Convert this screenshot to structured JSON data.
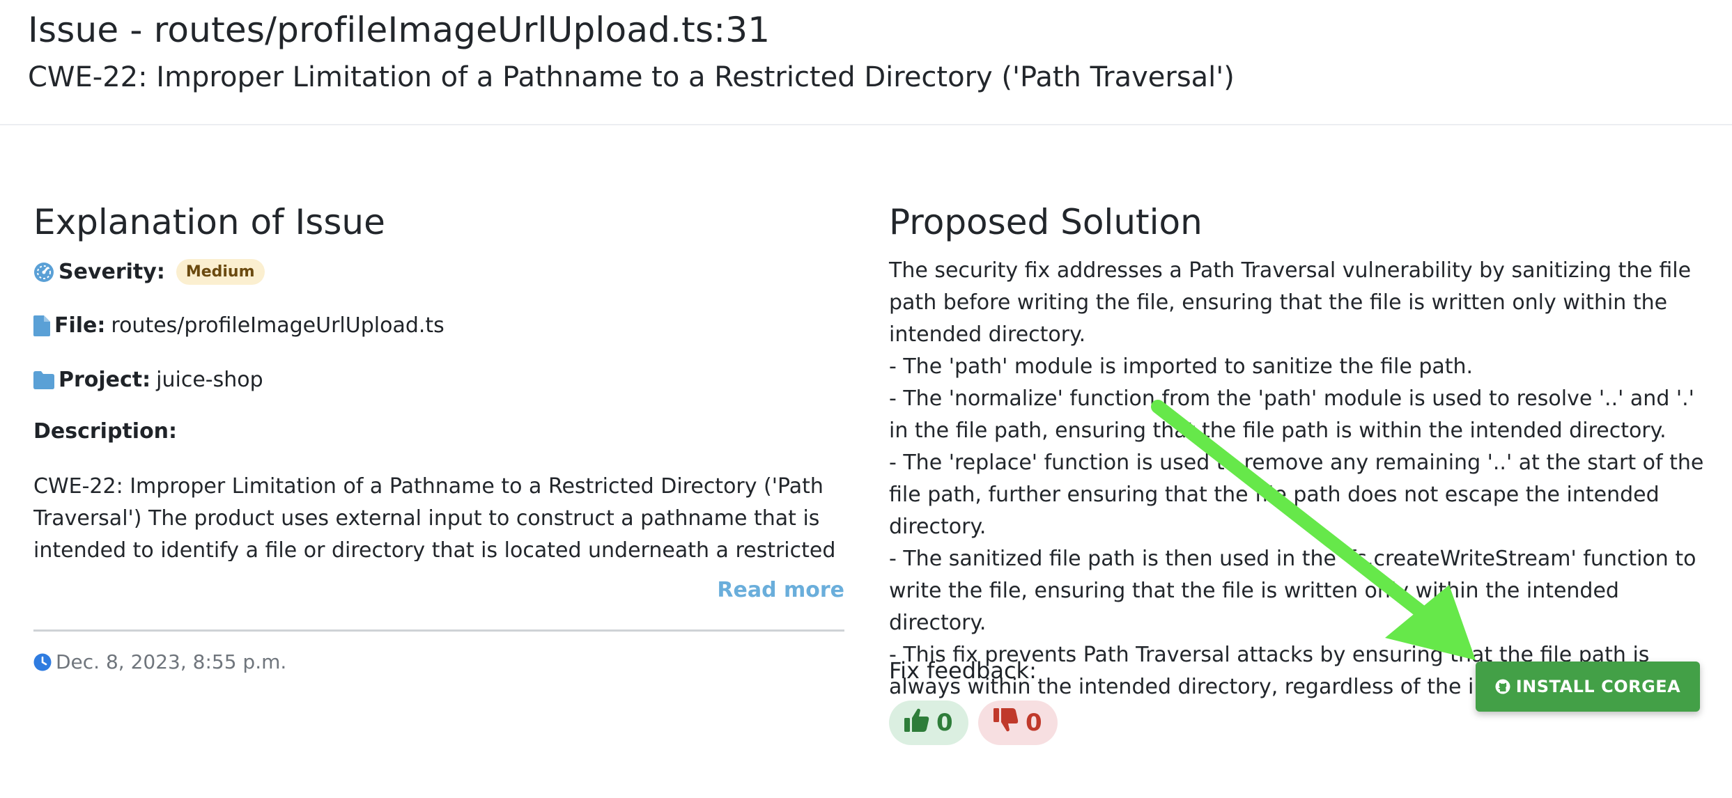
{
  "header": {
    "issue_title": "Issue - routes/profileImageUrlUpload.ts:31",
    "cwe_title": "CWE-22: Improper Limitation of a Pathname to a Restricted Directory ('Path Traversal')"
  },
  "explanation": {
    "heading": "Explanation of Issue",
    "severity_label": "Severity:",
    "severity_value": "Medium",
    "file_label": "File:",
    "file_value": "routes/profileImageUrlUpload.ts",
    "project_label": "Project:",
    "project_value": "juice-shop",
    "description_label": "Description:",
    "description_text": "CWE-22: Improper Limitation of a Pathname to a Restricted Directory ('Path Traversal') The product uses external input to construct a pathname that is intended to identify a file or directory that is located underneath a restricted",
    "read_more": "Read more",
    "timestamp": "Dec. 8, 2023, 8:55 p.m."
  },
  "solution": {
    "heading": "Proposed Solution",
    "lines": [
      "The security fix addresses a Path Traversal vulnerability by sanitizing the file path before writing the file, ensuring that the file is written only within the intended directory.",
      "- The 'path' module is imported to sanitize the file path.",
      "- The 'normalize' function from the 'path' module is used to resolve '..' and '.' in the file path, ensuring that the file path is within the intended directory.",
      "- The 'replace' function is used to remove any remaining '..' at the start of the file path, further ensuring that the file path does not escape the intended directory.",
      "- The sanitized file path is then used in the 'fs.createWriteStream' function to write the file, ensuring that the file is written only within the intended directory.",
      "- This fix prevents Path Traversal attacks by ensuring that the file path is always within the intended directory, regardless of the input."
    ],
    "feedback_label": "Fix feedback:",
    "thumbs_up_count": "0",
    "thumbs_down_count": "0"
  },
  "install_button": {
    "label": "INSTALL CORGEA"
  },
  "colors": {
    "install_green": "#43a047",
    "arrow_green": "#66e84a",
    "link_blue": "#6aaedb",
    "badge_bg": "#fbefd0"
  },
  "icons": [
    "dashboard-icon",
    "file-icon",
    "folder-icon",
    "clock-icon",
    "thumbs-up-icon",
    "thumbs-down-icon",
    "github-icon"
  ]
}
